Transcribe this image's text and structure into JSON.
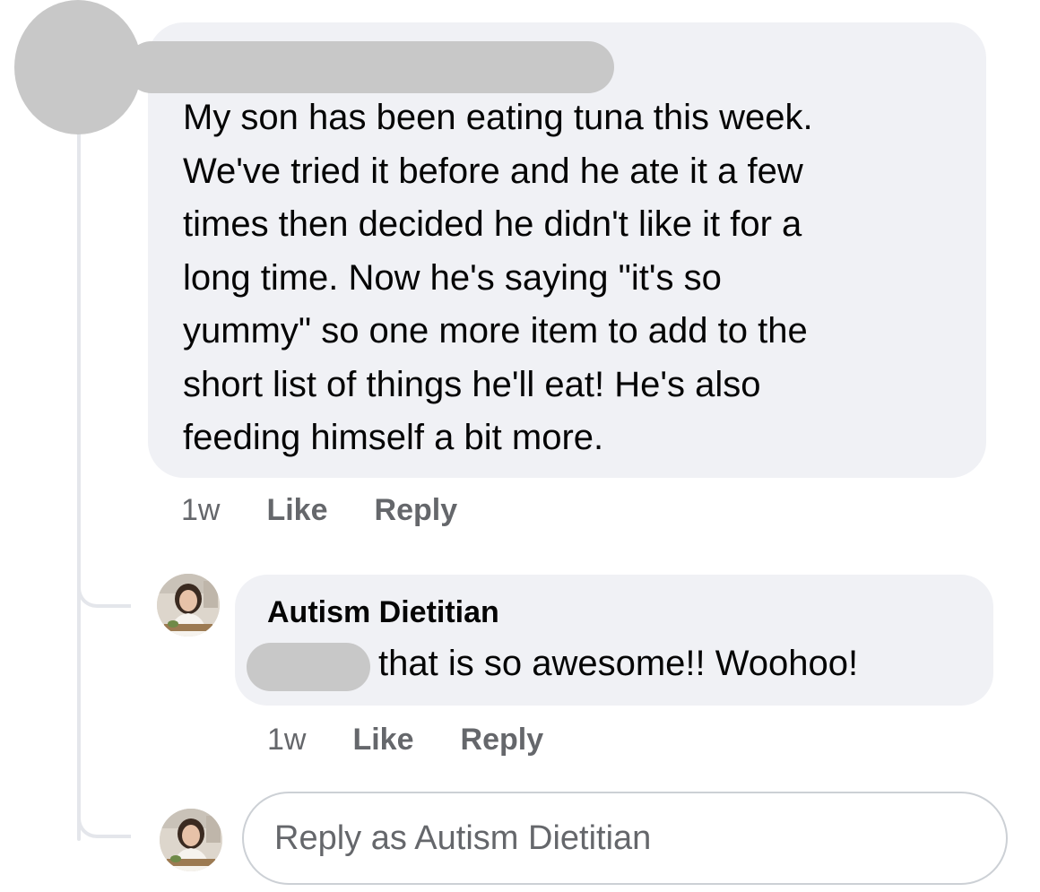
{
  "comment": {
    "text": "My son has been eating tuna this week.\nWe've tried it before and he ate it a few\ntimes then decided he didn't like it for a\nlong time. Now he's saying \"it's so\nyummy\" so one more item to add to the\nshort list of things he'll eat! He's also\nfeeding himself a bit more.",
    "time": "1w",
    "like_label": "Like",
    "reply_label": "Reply"
  },
  "reply": {
    "author": "Autism Dietitian",
    "text": "that is so awesome!! Woohoo!",
    "time": "1w",
    "like_label": "Like",
    "reply_label": "Reply"
  },
  "composer": {
    "placeholder": "Reply as Autism Dietitian"
  },
  "colors": {
    "bubble": "#f0f1f5",
    "secondary_text": "#65676b",
    "redaction": "#c8c8c8",
    "thread_line": "#e4e6eb"
  }
}
